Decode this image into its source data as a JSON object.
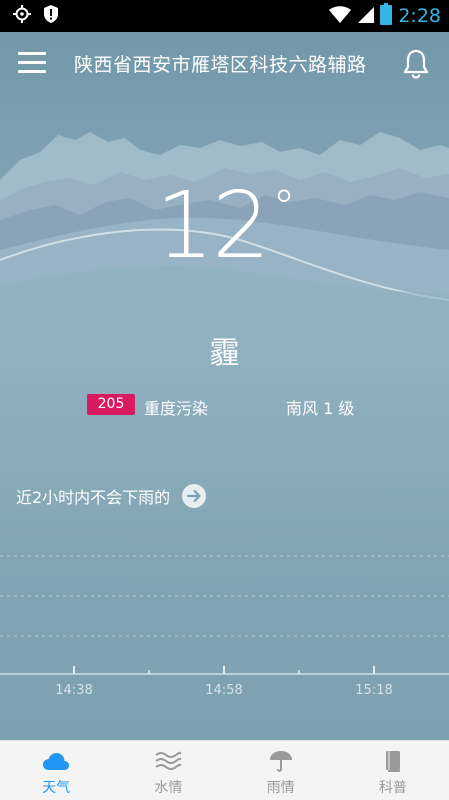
{
  "status_bar": {
    "time": "2:28"
  },
  "header": {
    "location": "陕西省西安市雁塔区科技六路辅路"
  },
  "weather": {
    "temperature": "12",
    "degree_symbol": "°",
    "condition": "霾",
    "aqi_value": "205",
    "aqi_label": "重度污染",
    "wind": "南风  1 级"
  },
  "rain_forecast": {
    "message": "近2小时内不会下雨的"
  },
  "chart_labels": [
    "14:38",
    "14:58",
    "15:18"
  ],
  "nav": {
    "items": [
      {
        "label": "天气",
        "icon": "cloud-icon",
        "active": true
      },
      {
        "label": "水情",
        "icon": "waves-icon",
        "active": false
      },
      {
        "label": "雨情",
        "icon": "umbrella-icon",
        "active": false
      },
      {
        "label": "科普",
        "icon": "book-icon",
        "active": false
      }
    ]
  },
  "colors": {
    "accent": "#2196f3",
    "aqi_badge": "#d81b60",
    "status_time": "#34b5e5"
  }
}
